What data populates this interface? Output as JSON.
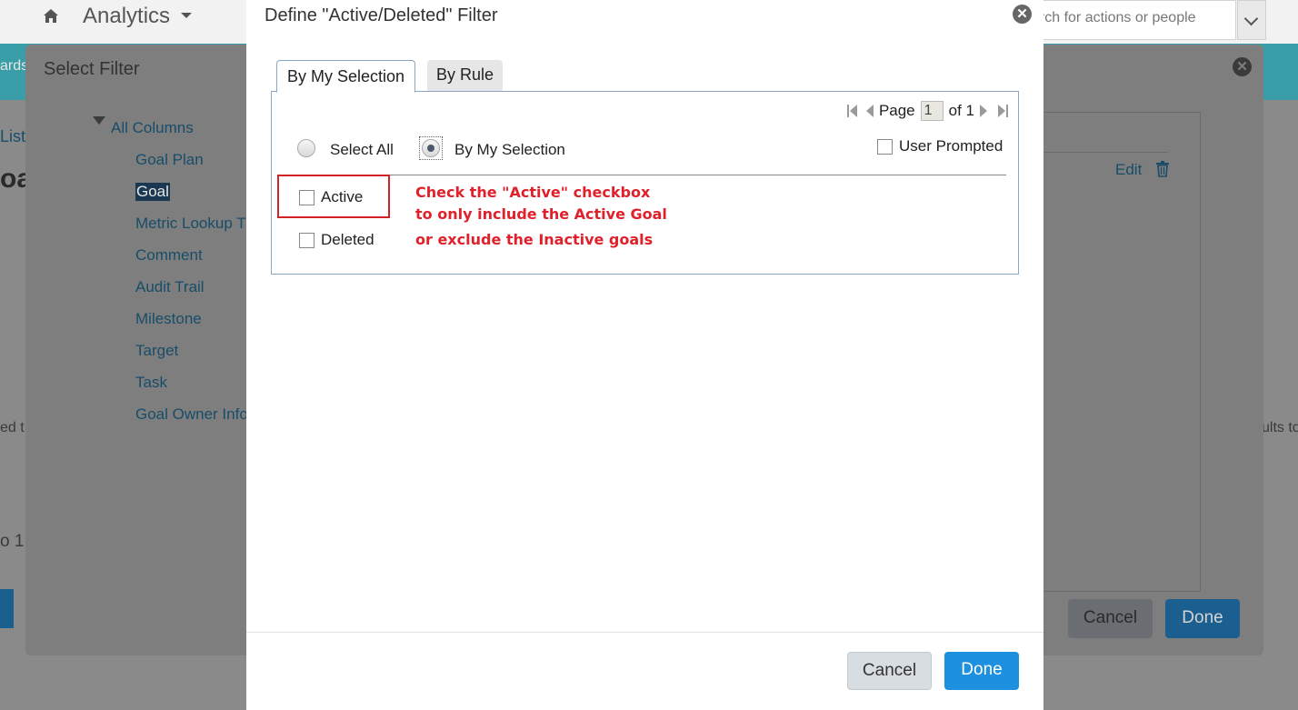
{
  "app": {
    "title": "Analytics",
    "search_placeholder": "Search for actions or people",
    "search_visible_text": "arch for actions or people"
  },
  "background_fragments": {
    "teal_left": "ards",
    "list": "List",
    "big_heading": "oa",
    "left_mid": "ed t",
    "left_low": "o 1",
    "right_mid": "ults to"
  },
  "select_filter": {
    "title": "Select Filter",
    "tree_root": "All Columns",
    "tree_items": [
      "Goal Plan",
      "Goal",
      "Metric Lookup T",
      "Comment",
      "Audit Trail",
      "Milestone",
      "Target",
      "Task",
      "Goal Owner Info"
    ],
    "selected_item": "Goal",
    "edit_label": "Edit",
    "cancel_label": "Cancel",
    "done_label": "Done"
  },
  "define_filter": {
    "title": "Define \"Active/Deleted\" Filter",
    "tabs": [
      {
        "label": "By My Selection",
        "active": true
      },
      {
        "label": "By Rule",
        "active": false
      }
    ],
    "pager": {
      "page_label": "Page",
      "page_value": "1",
      "of_label": "of 1"
    },
    "radio_options": [
      {
        "label": "Select All",
        "selected": false
      },
      {
        "label": "By My Selection",
        "selected": true
      }
    ],
    "user_prompted_label": "User Prompted",
    "options": [
      {
        "label": "Active",
        "checked": false
      },
      {
        "label": "Deleted",
        "checked": false
      }
    ],
    "callout_lines": [
      "Check the \"Active\" checkbox",
      "to only include the Active Goal",
      "or exclude the Inactive goals"
    ],
    "cancel_label": "Cancel",
    "done_label": "Done"
  },
  "colors": {
    "accent_blue": "#1e90e0",
    "annotation_red": "#e0202a",
    "teal_band": "#3a9ea8"
  }
}
